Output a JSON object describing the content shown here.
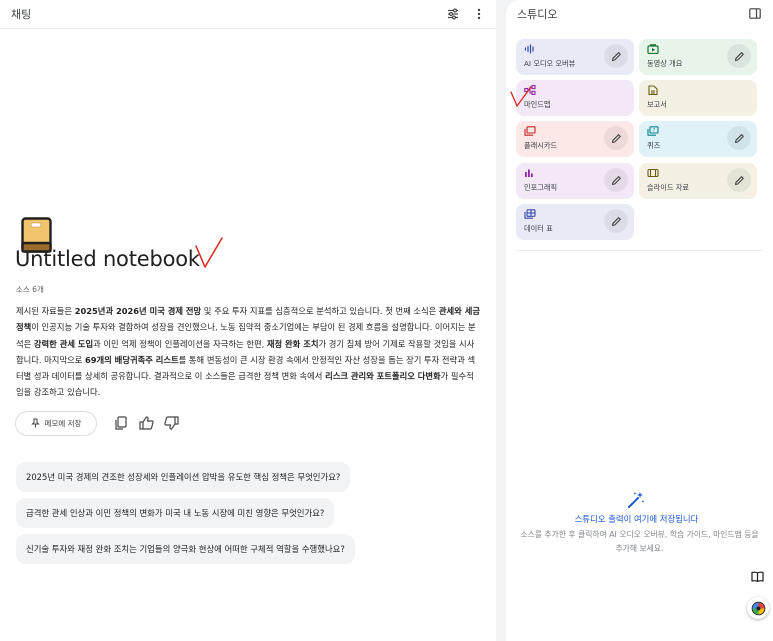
{
  "chat": {
    "title": "채팅",
    "notebook_title": "Untitled notebook",
    "source_count": "소스 6개",
    "summary": [
      {
        "t": "제시된 자료들은 ",
        "b": false
      },
      {
        "t": "2025년과 2026년 미국 경제 전망",
        "b": true
      },
      {
        "t": " 및 주요 투자 지표를 심층적으로 분석하고 있습니다. 첫 번째 소식은 ",
        "b": false
      },
      {
        "t": "관세와 세금 정책",
        "b": true
      },
      {
        "t": "이 인공지능 기술 투자와 결합하여 성장을 견인했으나, 노동 집약적 중소기업에는 부담이 된 경제 흐름을 설명합니다. 이어지는 분석은 ",
        "b": false
      },
      {
        "t": "강력한 관세 도입",
        "b": true
      },
      {
        "t": "과 이민 억제 정책이 인플레이션을 자극하는 한편, ",
        "b": false
      },
      {
        "t": "재정 완화 조치",
        "b": true
      },
      {
        "t": "가 경기 침체 방어 기제로 작용할 것임을 시사합니다. 마지막으로 ",
        "b": false
      },
      {
        "t": "69개의 배당귀족주 리스트",
        "b": true
      },
      {
        "t": "를 통해 변동성이 큰 시장 환경 속에서 안정적인 자산 성장을 돕는 장기 투자 전략과 섹터별 성과 데이터를 상세히 공유합니다. 결과적으로 이 소스들은 급격한 정책 변화 속에서 ",
        "b": false
      },
      {
        "t": "리스크 관리와 포트폴리오 다변화",
        "b": true
      },
      {
        "t": "가 필수적임을 강조하고 있습니다.",
        "b": false
      }
    ],
    "save_note_label": "메모에 저장",
    "suggestions": [
      "2025년 미국 경제의 견조한 성장세와 인플레이션 압박을 유도한 핵심 정책은 무엇인가요?",
      "급격한 관세 인상과 이민 정책의 변화가 미국 내 노동 시장에 미친 영향은 무엇인가요?",
      "신기술 투자와 재정 완화 조치는 기업들의 양극화 현상에 어떠한 구체적 역할을 수행했나요?"
    ]
  },
  "studio": {
    "title": "스튜디오",
    "tiles": [
      {
        "label": "AI 오디오 오버뷰",
        "icon": "audio-waveform-icon",
        "bg": "#e8eaf6",
        "color": "#3949ab"
      },
      {
        "label": "동영상 개요",
        "icon": "video-icon",
        "bg": "#e6f4ea",
        "color": "#137333"
      },
      {
        "label": "마인드맵",
        "icon": "mindmap-icon",
        "bg": "#f3e8f5",
        "color": "#8e24aa"
      },
      {
        "label": "보고서",
        "icon": "report-icon",
        "bg": "#f4f1e4",
        "color": "#6d5e0f"
      },
      {
        "label": "플래시카드",
        "icon": "flashcard-icon",
        "bg": "#fce8e6",
        "color": "#c5221f"
      },
      {
        "label": "퀴즈",
        "icon": "quiz-icon",
        "bg": "#e0f2f7",
        "color": "#00838f"
      },
      {
        "label": "인포그래픽",
        "icon": "infographic-icon",
        "bg": "#f3e8f5",
        "color": "#8e24aa"
      },
      {
        "label": "슬라이드 자료",
        "icon": "slides-icon",
        "bg": "#f4f1e4",
        "color": "#6d5e0f"
      },
      {
        "label": "데이터 표",
        "icon": "data-table-icon",
        "bg": "#e8eaf6",
        "color": "#3949ab"
      }
    ],
    "empty_title": "스튜디오 출력이 여기에 저장됩니다",
    "empty_desc": "소스를 추가한 후 클릭하여 AI 오디오 오버뷰, 학습 가이드, 마인드맵 등을 추가해 보세요."
  },
  "colors": {
    "accent": "#1a56db",
    "annotation": "#e0241b"
  }
}
